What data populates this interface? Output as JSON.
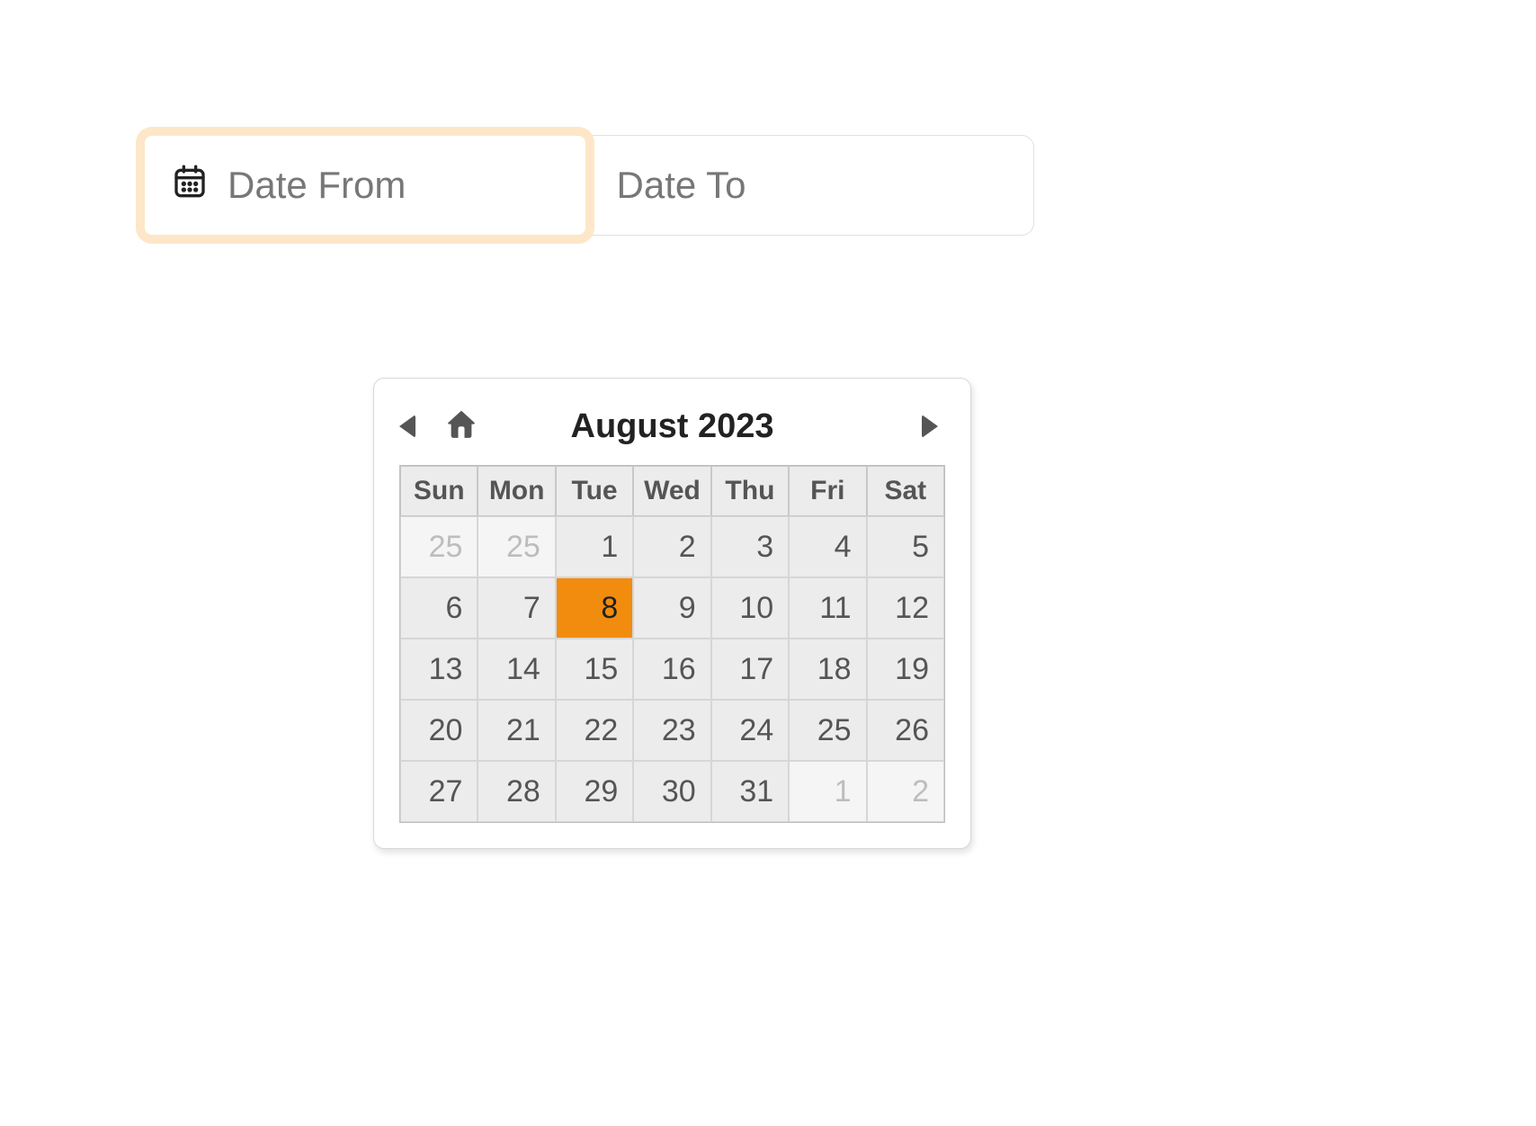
{
  "inputs": {
    "from_placeholder": "Date From",
    "to_placeholder": "Date To"
  },
  "calendar": {
    "month_label": "August 2023",
    "selected_day": 8,
    "weekdays": [
      "Sun",
      "Mon",
      "Tue",
      "Wed",
      "Thu",
      "Fri",
      "Sat"
    ],
    "weeks": [
      [
        {
          "n": 25,
          "out": true
        },
        {
          "n": 25,
          "out": true
        },
        {
          "n": 1
        },
        {
          "n": 2
        },
        {
          "n": 3
        },
        {
          "n": 4
        },
        {
          "n": 5
        }
      ],
      [
        {
          "n": 6
        },
        {
          "n": 7
        },
        {
          "n": 8,
          "sel": true
        },
        {
          "n": 9
        },
        {
          "n": 10
        },
        {
          "n": 11
        },
        {
          "n": 12
        }
      ],
      [
        {
          "n": 13
        },
        {
          "n": 14
        },
        {
          "n": 15
        },
        {
          "n": 16
        },
        {
          "n": 17
        },
        {
          "n": 18
        },
        {
          "n": 19
        }
      ],
      [
        {
          "n": 20
        },
        {
          "n": 21
        },
        {
          "n": 22
        },
        {
          "n": 23
        },
        {
          "n": 24
        },
        {
          "n": 25
        },
        {
          "n": 26
        }
      ],
      [
        {
          "n": 27
        },
        {
          "n": 28
        },
        {
          "n": 29
        },
        {
          "n": 30
        },
        {
          "n": 31
        },
        {
          "n": 1,
          "out": true
        },
        {
          "n": 2,
          "out": true
        }
      ]
    ]
  },
  "colors": {
    "accent": "#f28c0f",
    "focus_ring": "#fde7c8"
  }
}
